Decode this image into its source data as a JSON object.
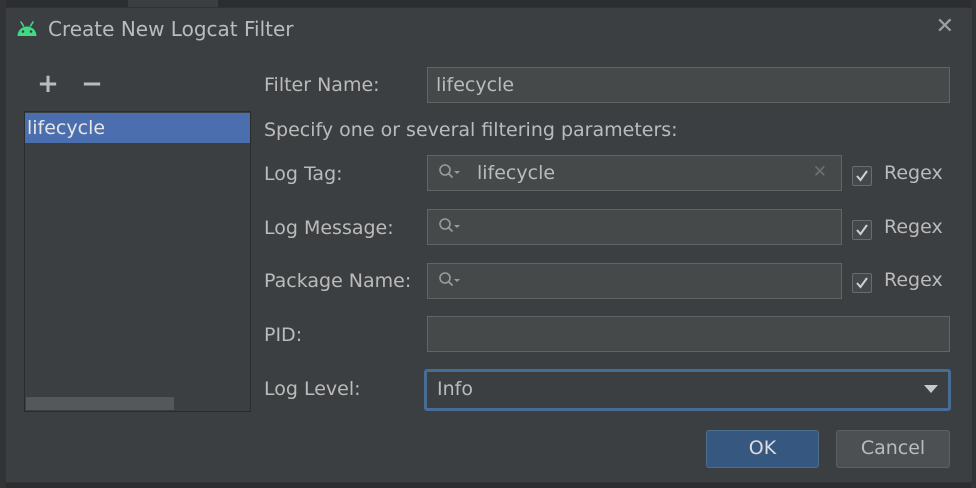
{
  "dialog": {
    "title": "Create New Logcat Filter",
    "title_icon": "android-icon",
    "close_icon": "close-icon"
  },
  "filter_list": {
    "add_label": "+",
    "remove_label": "−",
    "items": [
      {
        "label": "lifecycle",
        "selected": true
      }
    ]
  },
  "form": {
    "filter_name_label": "Filter Name:",
    "filter_name_value": "lifecycle",
    "hint": "Specify one or several filtering parameters:",
    "log_tag_label": "Log Tag:",
    "log_tag_value": "lifecycle",
    "log_tag_regex": true,
    "log_message_label": "Log Message:",
    "log_message_value": "",
    "log_message_regex": true,
    "package_name_label": "Package Name:",
    "package_name_value": "",
    "package_name_regex": true,
    "regex_label": "Regex",
    "pid_label": "PID:",
    "pid_value": "",
    "log_level_label": "Log Level:",
    "log_level_value": "Info"
  },
  "buttons": {
    "ok": "OK",
    "cancel": "Cancel"
  },
  "colors": {
    "dialog_bg": "#3c3f41",
    "selection": "#4b6eaf",
    "accent": "#365880",
    "android_green": "#3ddc84",
    "focus_border": "#466d94"
  }
}
